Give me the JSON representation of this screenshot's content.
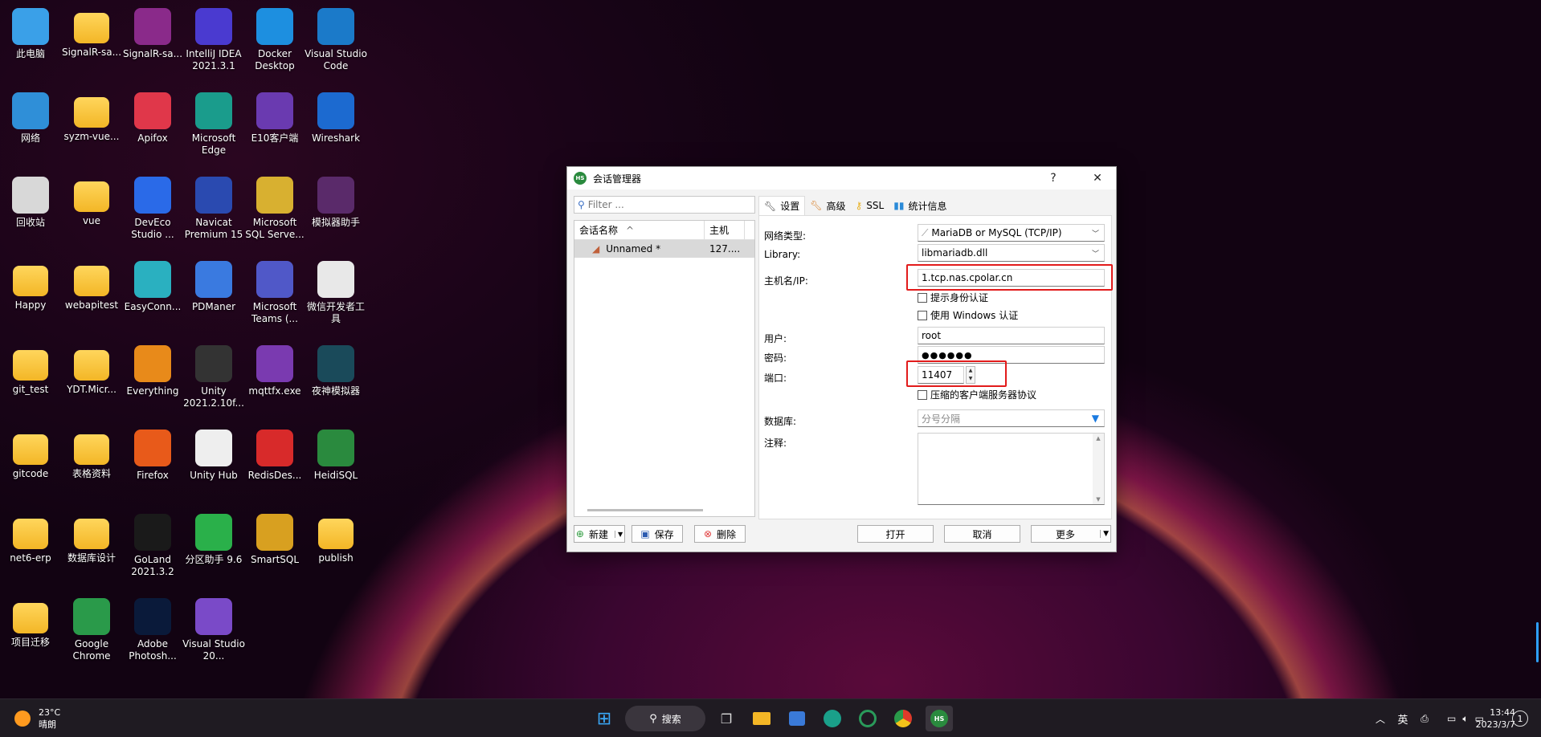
{
  "desktop": {
    "icons": [
      {
        "label": "此电脑",
        "icon": "computer-icon",
        "color": "#3aa0e8"
      },
      {
        "label": "SignalR-sa...",
        "icon": "folder-icon",
        "color": "#f3b626"
      },
      {
        "label": "SignalR-sa...",
        "icon": "winrar-icon",
        "color": "#8a2a8a"
      },
      {
        "label": "IntelliJ IDEA 2021.3.1",
        "icon": "intellij-icon",
        "color": "#4a3ad0"
      },
      {
        "label": "Docker Desktop",
        "icon": "docker-icon",
        "color": "#1d8fe0"
      },
      {
        "label": "Visual Studio Code",
        "icon": "vscode-icon",
        "color": "#1b7ac9"
      },
      {
        "label": "网络",
        "icon": "network-icon",
        "color": "#2f8fd8"
      },
      {
        "label": "syzm-vue...",
        "icon": "folder-icon",
        "color": "#f3b626"
      },
      {
        "label": "Apifox",
        "icon": "apifox-icon",
        "color": "#e0374a"
      },
      {
        "label": "Microsoft Edge",
        "icon": "edge-icon",
        "color": "#1a9c8c"
      },
      {
        "label": "E10客户端",
        "icon": "e10-icon",
        "color": "#6a3ab0"
      },
      {
        "label": "Wireshark",
        "icon": "wireshark-icon",
        "color": "#1c6ad0"
      },
      {
        "label": "回收站",
        "icon": "recycle-bin-icon",
        "color": "#d8d8d8"
      },
      {
        "label": "vue",
        "icon": "folder-icon",
        "color": "#f3b626"
      },
      {
        "label": "DevEco Studio ...",
        "icon": "deveco-icon",
        "color": "#2a6ae8"
      },
      {
        "label": "Navicat Premium 15",
        "icon": "navicat-icon",
        "color": "#2a4ab0"
      },
      {
        "label": "Microsoft SQL Serve...",
        "icon": "sqlserver-icon",
        "color": "#d8b030"
      },
      {
        "label": "模拟器助手",
        "icon": "nox-helper-icon",
        "color": "#5a2a6a"
      },
      {
        "label": "Happy",
        "icon": "folder-icon",
        "color": "#f3b626"
      },
      {
        "label": "webapitest",
        "icon": "folder-icon",
        "color": "#f3b626"
      },
      {
        "label": "EasyConn...",
        "icon": "easyconnect-icon",
        "color": "#2ab0c0"
      },
      {
        "label": "PDManer",
        "icon": "pdmaner-icon",
        "color": "#3a7ae0"
      },
      {
        "label": "Microsoft Teams (...",
        "icon": "teams-icon",
        "color": "#5058c8"
      },
      {
        "label": "微信开发者工具",
        "icon": "wechat-devtools-icon",
        "color": "#e8e8e8"
      },
      {
        "label": "git_test",
        "icon": "folder-icon",
        "color": "#f3b626"
      },
      {
        "label": "YDT.Micr...",
        "icon": "folder-icon",
        "color": "#f3b626"
      },
      {
        "label": "Everything",
        "icon": "everything-icon",
        "color": "#e88a1a"
      },
      {
        "label": "Unity 2021.2.10f...",
        "icon": "unity-icon",
        "color": "#333333"
      },
      {
        "label": "mqttfx.exe",
        "icon": "mqttfx-icon",
        "color": "#7a3ab0"
      },
      {
        "label": "夜神模拟器",
        "icon": "nox-icon",
        "color": "#1a4a5a"
      },
      {
        "label": "gitcode",
        "icon": "folder-icon",
        "color": "#f3b626"
      },
      {
        "label": "表格资料",
        "icon": "folder-icon",
        "color": "#f3b626"
      },
      {
        "label": "Firefox",
        "icon": "firefox-icon",
        "color": "#e85a1a"
      },
      {
        "label": "Unity Hub",
        "icon": "unity-hub-icon",
        "color": "#eeeeee"
      },
      {
        "label": "RedisDes...",
        "icon": "redis-icon",
        "color": "#d82a2a"
      },
      {
        "label": "HeidiSQL",
        "icon": "heidisql-icon",
        "color": "#2a8a3e"
      },
      {
        "label": "net6-erp",
        "icon": "folder-icon",
        "color": "#f3b626"
      },
      {
        "label": "数据库设计",
        "icon": "folder-icon",
        "color": "#f3b626"
      },
      {
        "label": "GoLand 2021.3.2",
        "icon": "goland-icon",
        "color": "#1a1a1a"
      },
      {
        "label": "分区助手 9.6",
        "icon": "partition-assistant-icon",
        "color": "#2ab04a"
      },
      {
        "label": "SmartSQL",
        "icon": "smartsql-icon",
        "color": "#d8a020"
      },
      {
        "label": "publish",
        "icon": "folder-icon",
        "color": "#f3b626"
      },
      {
        "label": "项目迁移",
        "icon": "folder-icon",
        "color": "#f3b626"
      },
      {
        "label": "Google Chrome",
        "icon": "chrome-icon",
        "color": "#2a9a4a"
      },
      {
        "label": "Adobe Photosh...",
        "icon": "photoshop-icon",
        "color": "#0a1a3a"
      },
      {
        "label": "Visual Studio 20...",
        "icon": "visual-studio-icon",
        "color": "#7a4ac8"
      }
    ]
  },
  "dialog": {
    "title": "会话管理器",
    "app_badge": "HS",
    "help": "?",
    "close": "✕",
    "filter_placeholder": "Filter ...",
    "list_headers": {
      "name": "会话名称",
      "sort": "^",
      "host": "主机"
    },
    "session": {
      "name": "Unnamed *",
      "host": "127...."
    },
    "buttons": {
      "new": "新建",
      "save": "保存",
      "delete": "删除",
      "open": "打开",
      "cancel": "取消",
      "more": "更多"
    },
    "tabs": [
      "设置",
      "高级",
      "SSL",
      "统计信息"
    ],
    "fields": {
      "network_type_label": "网络类型:",
      "network_type_value": "MariaDB or MySQL (TCP/IP)",
      "library_label": "Library:",
      "library_value": "libmariadb.dll",
      "host_label": "主机名/IP:",
      "host_value": "1.tcp.nas.cpolar.cn",
      "prompt_auth": "提示身份认证",
      "windows_auth": "使用 Windows 认证",
      "user_label": "用户:",
      "user_value": "root",
      "password_label": "密码:",
      "password_value": "●●●●●●",
      "port_label": "端口:",
      "port_value": "11407",
      "compress": "压缩的客户端服务器协议",
      "database_label": "数据库:",
      "database_placeholder": "分号分隔",
      "comment_label": "注释:"
    }
  },
  "taskbar": {
    "weather_temp": "23°C",
    "weather_desc": "晴朗",
    "search_label": "搜索",
    "ime": "英",
    "time": "13:44",
    "date": "2023/3/7",
    "notification_count": "1"
  }
}
